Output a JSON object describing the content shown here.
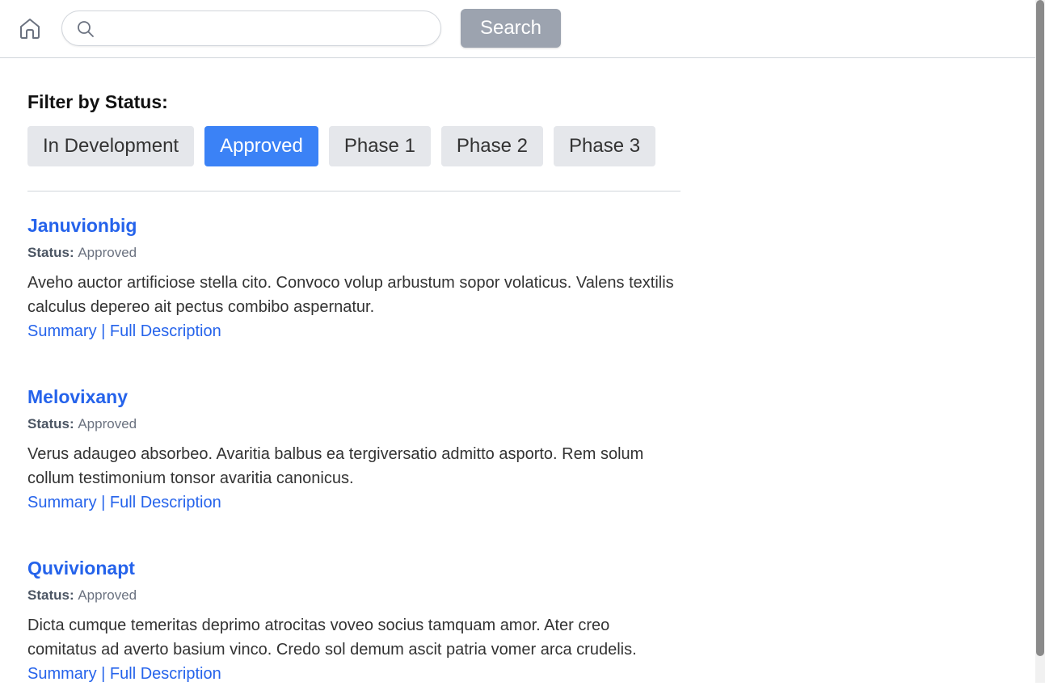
{
  "header": {
    "home_icon": "home-icon",
    "search": {
      "icon": "search-icon",
      "placeholder": "",
      "value": ""
    },
    "search_button_label": "Search",
    "search_button_color": "#9ca3af"
  },
  "filters": {
    "title": "Filter by Status:",
    "options": [
      {
        "label": "In Development",
        "active": false
      },
      {
        "label": "Approved",
        "active": true
      },
      {
        "label": "Phase 1",
        "active": false
      },
      {
        "label": "Phase 2",
        "active": false
      },
      {
        "label": "Phase 3",
        "active": false
      }
    ],
    "active_color": "#3b82f6"
  },
  "results": [
    {
      "name": "Januvionbig",
      "status_label": "Status:",
      "status": "Approved",
      "description": "Aveho auctor artificiose stella cito. Convoco volup arbustum sopor volaticus. Valens textilis calculus depereo ait pectus combibo aspernatur.",
      "summary_link": "Summary",
      "separator": "|",
      "full_link": "Full Description"
    },
    {
      "name": "Melovixany",
      "status_label": "Status:",
      "status": "Approved",
      "description": "Verus adaugeo absorbeo. Avaritia balbus ea tergiversatio admitto asporto. Rem solum collum testimonium tonsor avaritia canonicus.",
      "summary_link": "Summary",
      "separator": "|",
      "full_link": "Full Description"
    },
    {
      "name": "Quvivionapt",
      "status_label": "Status:",
      "status": "Approved",
      "description": "Dicta cumque temeritas deprimo atrocitas voveo socius tamquam amor. Ater creo comitatus ad averto basium vinco. Credo sol demum ascit patria vomer arca crudelis.",
      "summary_link": "Summary",
      "separator": "|",
      "full_link": "Full Description"
    }
  ],
  "colors": {
    "link": "#2563eb",
    "text": "#333333"
  }
}
